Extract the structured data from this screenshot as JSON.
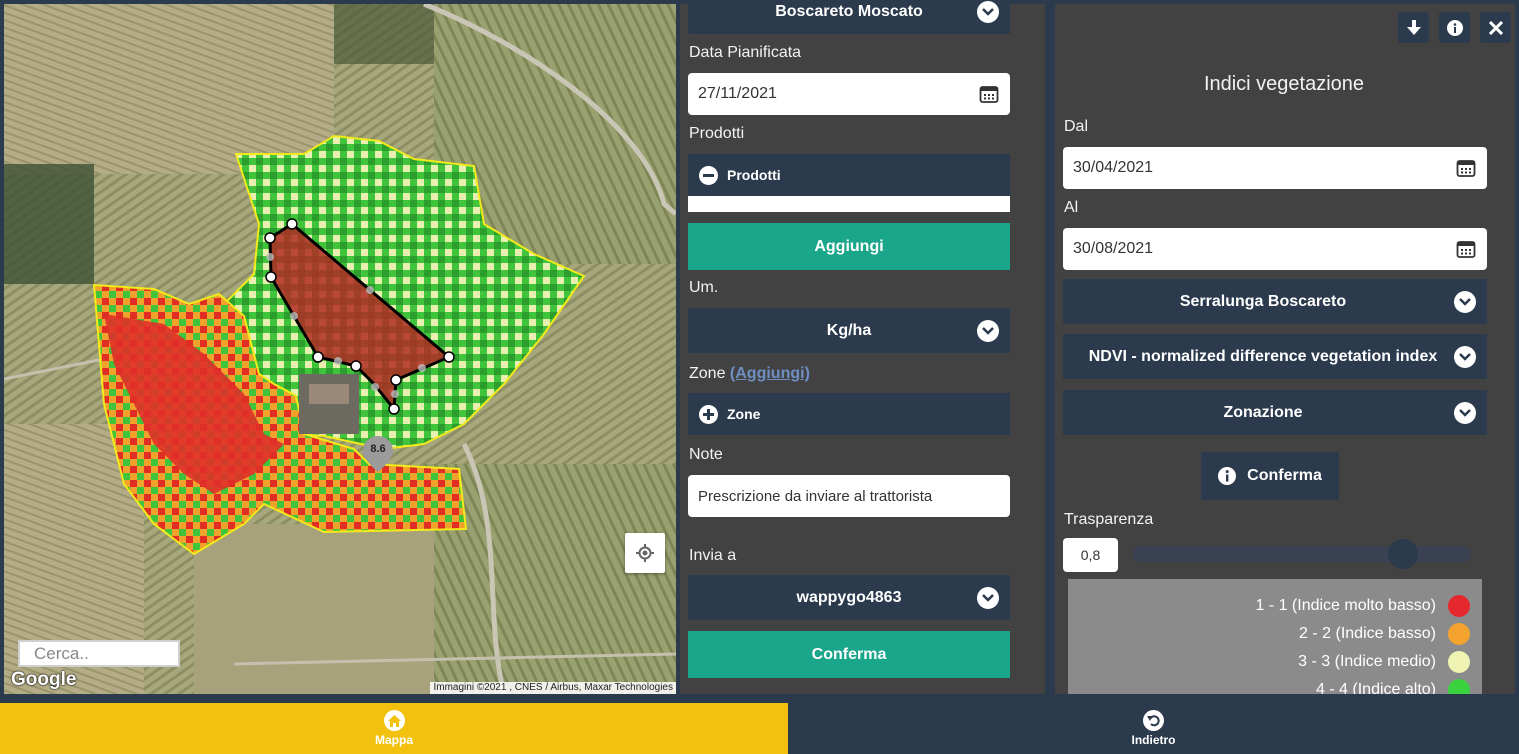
{
  "map": {
    "search_placeholder": "Cerca..",
    "logo": "Google",
    "attribution": "Immagini ©2021 , CNES / Airbus, Maxar Technologies",
    "marker_value": "8.6"
  },
  "planning": {
    "vineyard_select": "Boscareto Moscato",
    "date_label": "Data Pianificata",
    "date_value": "27/11/2021",
    "products_label": "Prodotti",
    "products_toggle": "Prodotti",
    "add_button": "Aggiungi",
    "unit_label": "Um.",
    "unit_select": "Kg/ha",
    "zones_label": "Zone",
    "zones_link": "(Aggiungi)",
    "zones_toggle": "Zone",
    "notes_label": "Note",
    "notes_value": "Prescrizione da inviare al trattorista",
    "send_to_label": "Invia a",
    "send_to_select": "wappygo4863",
    "confirm_button": "Conferma"
  },
  "vegetation": {
    "title": "Indici vegetazione",
    "from_label": "Dal",
    "from_value": "30/04/2021",
    "to_label": "Al",
    "to_value": "30/08/2021",
    "vineyard_select": "Serralunga Boscareto",
    "index_select": "NDVI - normalized difference vegetation index",
    "mode_select": "Zonazione",
    "confirm_button": "Conferma",
    "transparency_label": "Trasparenza",
    "transparency_value": "0,8",
    "transparency_fraction": 0.8,
    "legend": [
      {
        "label": "1 - 1 (Indice molto basso)",
        "color": "#e5282d"
      },
      {
        "label": "2 - 2 (Indice basso)",
        "color": "#f3a22e"
      },
      {
        "label": "3 - 3 (Indice medio)",
        "color": "#eef3b3"
      },
      {
        "label": "4 - 4 (Indice alto)",
        "color": "#3bd23f"
      }
    ]
  },
  "nav": {
    "home_label": "Mappa",
    "back_label": "Indietro"
  }
}
